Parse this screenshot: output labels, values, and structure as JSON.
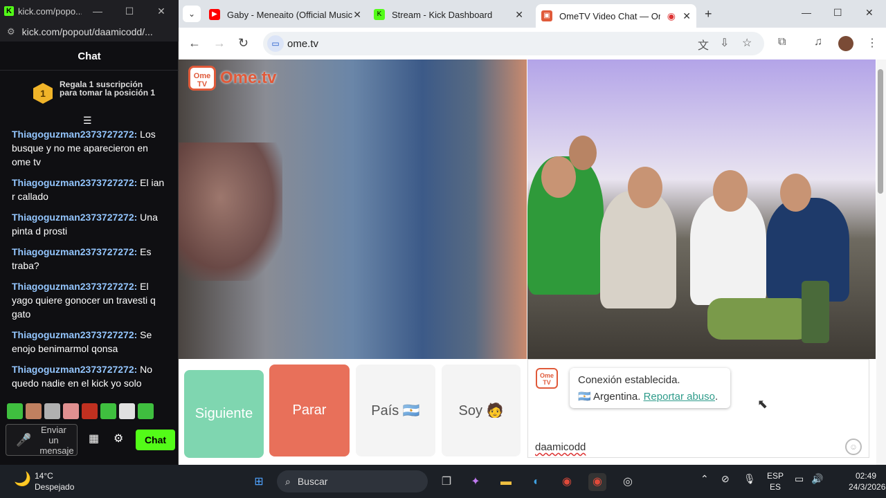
{
  "kick_window": {
    "title": "kick.com/popo...",
    "url": "kick.com/popout/daamicodd/...",
    "chat_header": "Chat",
    "gift_badge": "1",
    "gift_text": "Regala 1 suscripción para tomar la posición 1",
    "messages": [
      {
        "user": "Thiagoguzman2373727272:",
        "text": " Los busque y no me aparecieron en ome tv"
      },
      {
        "user": "Thiagoguzman2373727272:",
        "text": " El ian r callado"
      },
      {
        "user": "Thiagoguzman2373727272:",
        "text": " Una pinta d prosti"
      },
      {
        "user": "Thiagoguzman2373727272:",
        "text": " Es traba?"
      },
      {
        "user": "Thiagoguzman2373727272:",
        "text": " El yago quiere gonocer un travesti q gato"
      },
      {
        "user": "Thiagoguzman2373727272:",
        "text": " Se enojo benimarmol qonsa"
      },
      {
        "user": "Thiagoguzman2373727272:",
        "text": " No quedo nadie en el kick yo solo"
      }
    ],
    "input_placeholder": "Enviar un mensaje",
    "send_label": "Chat",
    "emote_colors": [
      "#3fbf3f",
      "#c08060",
      "#b0b0b0",
      "#e09090",
      "#c03020",
      "#3fbf3f",
      "#e0e0e0",
      "#3fbf3f"
    ]
  },
  "browser": {
    "tabs": [
      {
        "title": "Gaby - Meneaito (Official Music",
        "favicon_color": "#ff0000"
      },
      {
        "title": "Stream - Kick Dashboard",
        "favicon_color": "#53fc18"
      },
      {
        "title": "OmeTV Video Chat — Ome",
        "favicon_color": "#e05a3a"
      }
    ],
    "url": "ome.tv"
  },
  "ometv": {
    "logo_text": "Ome.tv",
    "logo_small": "Ome TV",
    "buttons": {
      "next": "Siguiente",
      "stop": "Parar",
      "country": "País 🇦🇷",
      "gender": "Soy 🧑"
    },
    "status_line": "Conexión establecida.",
    "country_text": "🇦🇷 Argentina.",
    "report_link": "Reportar abuso",
    "report_period": ".",
    "typed_text": "daamicodd"
  },
  "taskbar": {
    "temperature": "14°C",
    "weather": "Despejado",
    "search_placeholder": "Buscar",
    "lang_top": "ESP",
    "lang_bottom": "ES",
    "time": "02:49",
    "date": "24/3/2026"
  }
}
